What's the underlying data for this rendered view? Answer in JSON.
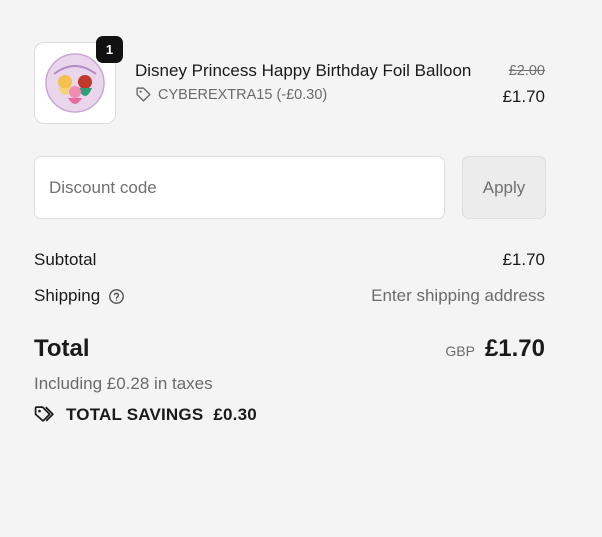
{
  "cart": {
    "item": {
      "quantity": "1",
      "title": "Disney Princess Happy Birthday Foil Balloon",
      "discount_text": "CYBEREXTRA15 (-£0.30)",
      "original_price": "£2.00",
      "price": "£1.70",
      "thumbnail_icon": "balloon-thumbnail",
      "discount_icon": "tag-icon"
    }
  },
  "discount": {
    "placeholder": "Discount code",
    "apply_label": "Apply"
  },
  "summary": {
    "subtotal_label": "Subtotal",
    "subtotal_value": "£1.70",
    "shipping_label": "Shipping",
    "shipping_value": "Enter shipping address",
    "help_icon": "question-circle-icon",
    "total_label": "Total",
    "currency": "GBP",
    "total_value": "£1.70",
    "taxes_text": "Including £0.28 in taxes",
    "savings_label": "TOTAL SAVINGS",
    "savings_value": "£0.30",
    "savings_icon": "tags-icon"
  },
  "colors": {
    "background": "#f4f4f4",
    "text": "#1a1a1a",
    "muted": "#6b6b6b",
    "badge": "#111111"
  }
}
